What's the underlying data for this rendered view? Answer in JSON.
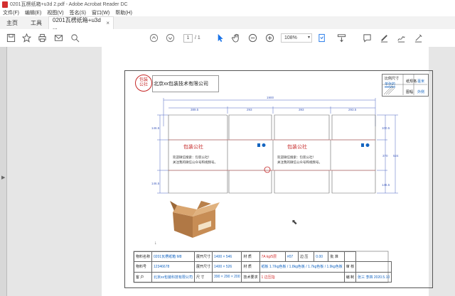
{
  "window": {
    "title": "0201瓦楞纸箱+u3d 2.pdf - Adobe Acrobat Reader DC"
  },
  "menu": {
    "items": [
      "文件(F)",
      "编辑(E)",
      "视图(V)",
      "签名(S)",
      "窗口(W)",
      "帮助(H)"
    ]
  },
  "tabs": {
    "home": "主页",
    "tools": "工具",
    "doc": "0201瓦楞纸箱+u3d ...",
    "close": "×"
  },
  "toolbar": {
    "page_current": "1",
    "page_total": "/ 1",
    "zoom": "108%"
  },
  "drawing": {
    "logo": [
      "包装",
      "公社"
    ],
    "company": "北京xx包装技术有限公司",
    "corner": {
      "label1": "比例尺寸",
      "value1": "单张的",
      "label2": "纸规格",
      "value2": "毫米",
      "label3": "图幅",
      "value3": "外侧"
    },
    "panel_title": "包装公社",
    "panel_text1": "欢迎微信搜索：包装公社！",
    "panel_text2": "关注我的微信公众号和视频号。",
    "dims": {
      "total": "1900",
      "p1": "389.5",
      "p2": "293",
      "p3": "393",
      "p4": "293.5",
      "left_top": "146.5",
      "left_bottom": "146.5",
      "right_top": "100.5",
      "right_mid": "370",
      "right_right": "524",
      "right_bottom": "146.5"
    }
  },
  "table": {
    "rows": [
      [
        "物料名称",
        "0201瓦楞纸箱 M8",
        "展开尺寸",
        "1400 × 546",
        "材 质",
        "7A kg/5层",
        "#07",
        "边 压",
        "0.00",
        "批 准",
        ""
      ],
      [
        "物料号",
        "12346678",
        "展开尺寸",
        "1400 × 526",
        "材 质",
        "纸板 1.7/kg色板 / 1.8kg色板 / 1.7kg色板 / 1.9kg色板",
        "",
        "",
        "",
        "审 核",
        ""
      ],
      [
        "客 户",
        "北京xx包装科技有限公司",
        "尺 寸",
        "390 × 290 × 200",
        "技术要求",
        "1 边压指",
        "",
        "",
        "",
        "编 制",
        "张三 李四 2020.5.10"
      ]
    ]
  },
  "colors": {
    "brand_red": "#c62828",
    "link_blue": "#1565c0",
    "accent_blue": "#1a73e8"
  }
}
